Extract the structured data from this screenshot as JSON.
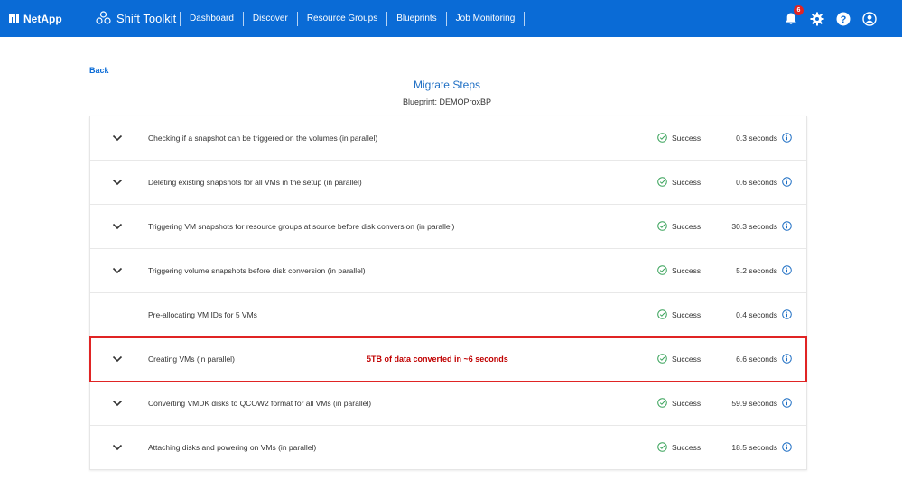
{
  "header": {
    "brand": "NetApp",
    "app_name": "Shift Toolkit",
    "nav": [
      "Dashboard",
      "Discover",
      "Resource Groups",
      "Blueprints",
      "Job Monitoring"
    ],
    "notifications_count": "6",
    "icons": [
      "bell-icon",
      "gear-icon",
      "help-icon",
      "user-icon"
    ]
  },
  "page": {
    "back_label": "Back",
    "title": "Migrate Steps",
    "subtitle": "Blueprint: DEMOProxBP"
  },
  "steps": [
    {
      "label": "Checking if a snapshot can be triggered on the volumes (in parallel)",
      "status": "Success",
      "duration": "0.3 seconds",
      "expandable": true
    },
    {
      "label": "Deleting existing snapshots for all VMs in the setup (in parallel)",
      "status": "Success",
      "duration": "0.6 seconds",
      "expandable": true
    },
    {
      "label": "Triggering VM snapshots for resource groups at source before disk conversion (in parallel)",
      "status": "Success",
      "duration": "30.3 seconds",
      "expandable": true
    },
    {
      "label": "Triggering volume snapshots before disk conversion (in parallel)",
      "status": "Success",
      "duration": "5.2 seconds",
      "expandable": true
    },
    {
      "label": "Pre-allocating VM IDs for 5 VMs",
      "status": "Success",
      "duration": "0.4 seconds",
      "expandable": false
    },
    {
      "label": "Creating VMs (in parallel)",
      "status": "Success",
      "duration": "6.6 seconds",
      "expandable": true,
      "annotation": "5TB of data converted in ~6 seconds"
    },
    {
      "label": "Converting VMDK disks to QCOW2 format for all VMs (in parallel)",
      "status": "Success",
      "duration": "59.9 seconds",
      "expandable": true
    },
    {
      "label": "Attaching disks and powering on VMs (in parallel)",
      "status": "Success",
      "duration": "18.5 seconds",
      "expandable": true
    }
  ],
  "colors": {
    "header_bg": "#0a6bd6",
    "success": "#3aa35b",
    "highlight": "#e02424",
    "annotation_text": "#c00000"
  }
}
